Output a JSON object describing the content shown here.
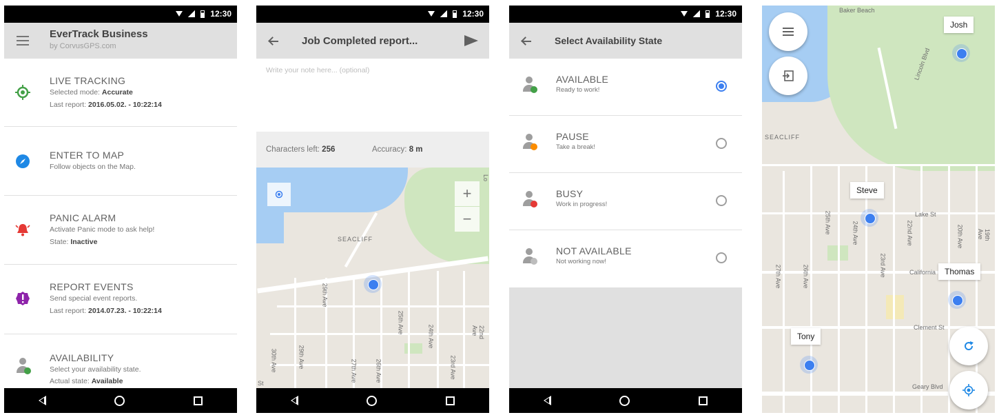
{
  "status_time": "12:30",
  "screen1": {
    "app_title": "EverTrack Business",
    "app_subtitle": "by CorvusGPS.com",
    "items": [
      {
        "title": "LIVE TRACKING",
        "line1": "Selected mode: ",
        "line1_bold": "Accurate",
        "line2": "Last report: ",
        "line2_bold": "2016.05.02. - 10:22:14",
        "icon": "target-icon",
        "color": "#43a047"
      },
      {
        "title": "ENTER TO MAP",
        "line1": "Follow objects on the Map.",
        "icon": "compass-icon",
        "color": "#1e88e5"
      },
      {
        "title": "PANIC ALARM",
        "line1": "Activate Panic mode to ask help!",
        "line2": "State: ",
        "line2_bold": "Inactive",
        "icon": "alarm-bell-icon",
        "color": "#e53935"
      },
      {
        "title": "REPORT EVENTS",
        "line1": "Send special event reports.",
        "line2": "Last report: ",
        "line2_bold": "2014.07.23. - 10:22:14",
        "icon": "alert-badge-icon",
        "color": "#8e24aa"
      },
      {
        "title": "AVAILABILITY",
        "line1": "Select your availability state.",
        "line2": "Actual state: ",
        "line2_bold": "Available",
        "icon": "person-available-icon",
        "color": "#43a047"
      }
    ]
  },
  "screen2": {
    "title": "Job Completed report...",
    "note_placeholder": "Write your note here... (optional)",
    "chars_label": "Characters left: ",
    "chars_value": "256",
    "accuracy_label": "Accuracy: ",
    "accuracy_value": "8 m",
    "map_labels": {
      "seacliff": "SEACLIFF",
      "ave_29": "29th Ave",
      "ave_25": "25th Ave",
      "ave_24": "24th Ave",
      "ave_22": "22nd Ave",
      "ave_30": "30th Ave",
      "ave_29b": "29th Ave",
      "ave_27": "27th Ave",
      "ave_26": "26th Ave",
      "ave_23": "23rd Ave",
      "st": "St",
      "lo": "Lo"
    },
    "zoom_in": "+",
    "zoom_out": "−"
  },
  "screen3": {
    "title": "Select Availability State",
    "states": [
      {
        "name": "AVAILABLE",
        "desc": "Ready to work!",
        "color": "#43a047",
        "selected": true
      },
      {
        "name": "PAUSE",
        "desc": "Take a break!",
        "color": "#fb8c00",
        "selected": false
      },
      {
        "name": "BUSY",
        "desc": "Work in progress!",
        "color": "#e53935",
        "selected": false
      },
      {
        "name": "NOT AVAILABLE",
        "desc": "Not working now!",
        "color": "#9e9e9e",
        "selected": false
      }
    ]
  },
  "screen4": {
    "people": [
      "Josh",
      "Steve",
      "Thomas",
      "Tony"
    ],
    "map_labels": {
      "baker_beach": "Baker Beach",
      "lincoln": "Lincoln Blvd",
      "seacliff": "SEACLIFF",
      "lake": "Lake St",
      "california": "California",
      "clement": "Clement St",
      "geary": "Geary Blvd",
      "ave_25": "25th Ave",
      "ave_24": "24th Ave",
      "ave_23": "23rd Ave",
      "ave_22": "22nd Ave",
      "ave_20": "20th Ave",
      "ave_19": "19th Ave",
      "ave_27": "27th Ave",
      "ave_26": "26th Ave"
    }
  }
}
